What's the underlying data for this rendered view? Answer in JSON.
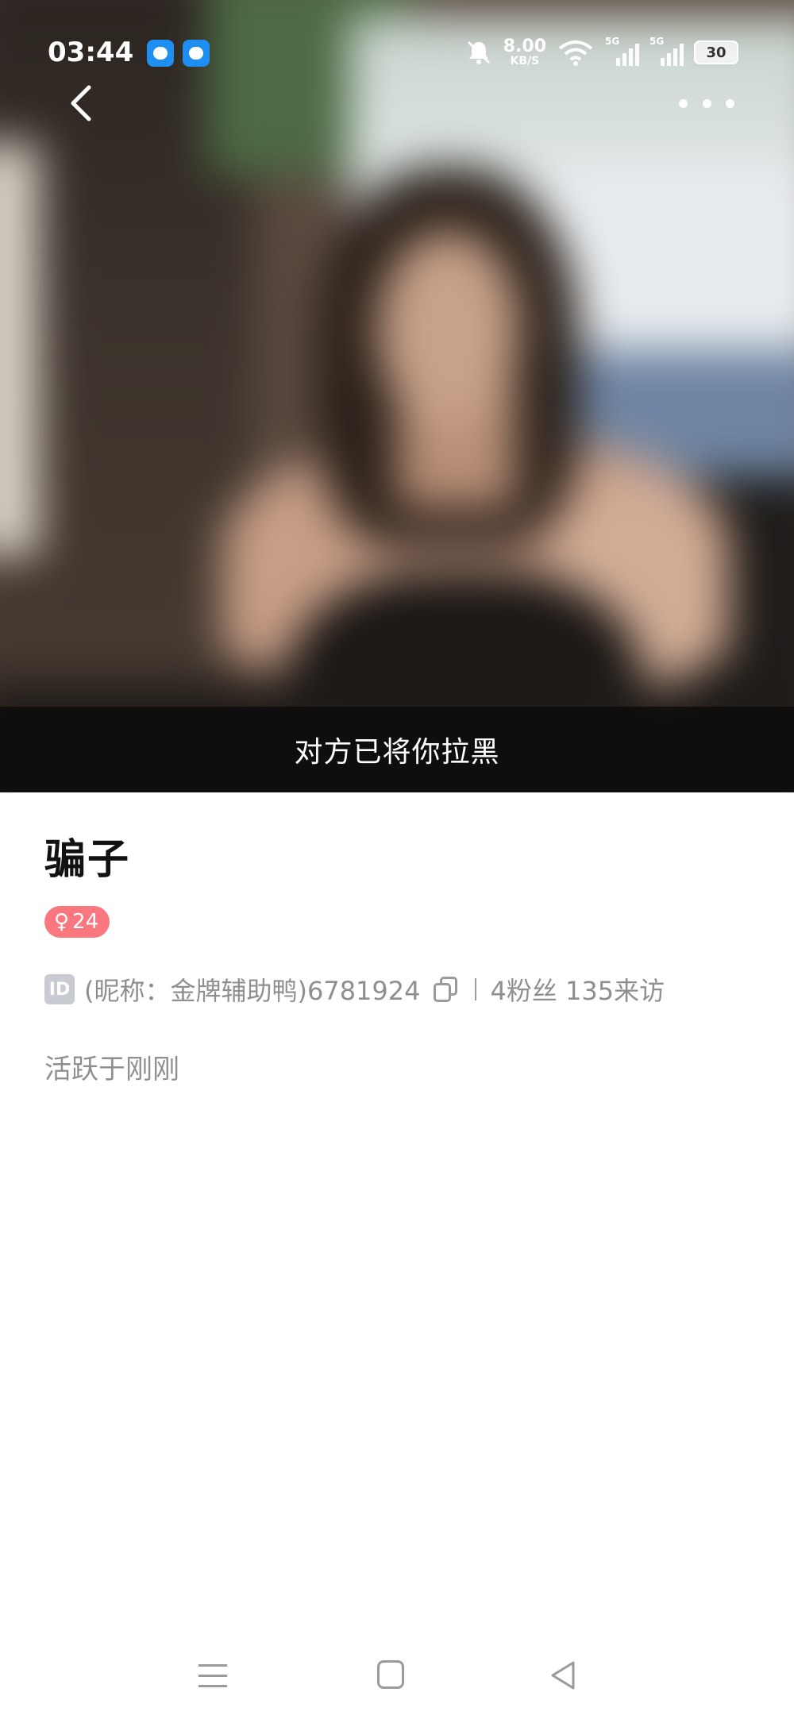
{
  "status_bar": {
    "time": "03:44",
    "net_speed_value": "8.00",
    "net_speed_unit": "KB/S",
    "signal_1_label": "5G",
    "signal_2_label": "5G",
    "battery_level": "30",
    "icons": [
      "app-icon-1",
      "app-icon-2",
      "mute-icon",
      "wifi-icon",
      "signal-icon",
      "signal-icon",
      "battery-icon"
    ]
  },
  "nav": {
    "back_icon": "chevron-left-icon",
    "more_icon": "more-dots-icon"
  },
  "hero": {
    "blocked_message": "对方已将你拉黑"
  },
  "profile": {
    "name": "骗子",
    "gender_symbol": "♀",
    "age": "24",
    "id_badge": "ID",
    "id_text": "(昵称：金牌辅助鸭)6781924",
    "stats_text": "4粉丝 135来访",
    "active_status": "活跃于刚刚"
  },
  "colors": {
    "gender_badge": "#f9787f",
    "secondary_text": "#8f8f8f",
    "name_text": "#111111"
  }
}
